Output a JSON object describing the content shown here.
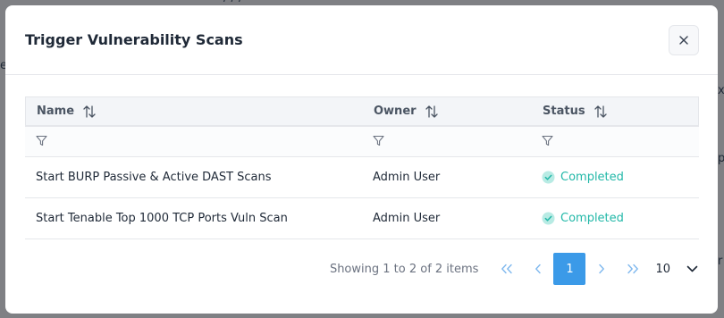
{
  "background": {
    "fragments": [
      "/ / /",
      "x",
      "p",
      "r",
      "e"
    ]
  },
  "modal": {
    "title": "Trigger Vulnerability Scans",
    "close_label": "×"
  },
  "grid": {
    "columns": [
      "Name",
      "Owner",
      "Status"
    ],
    "rows": [
      {
        "name": "Start BURP Passive & Active DAST Scans",
        "owner": "Admin User",
        "status": "Completed"
      },
      {
        "name": "Start Tenable Top 1000 TCP Ports Vuln Scan",
        "owner": "Admin User",
        "status": "Completed"
      }
    ]
  },
  "pager": {
    "info": "Showing 1 to 2 of 2 items",
    "current_page": "1",
    "page_size": "10"
  },
  "colors": {
    "accent": "#3b9ae8",
    "status_completed": "#22b8a8"
  }
}
